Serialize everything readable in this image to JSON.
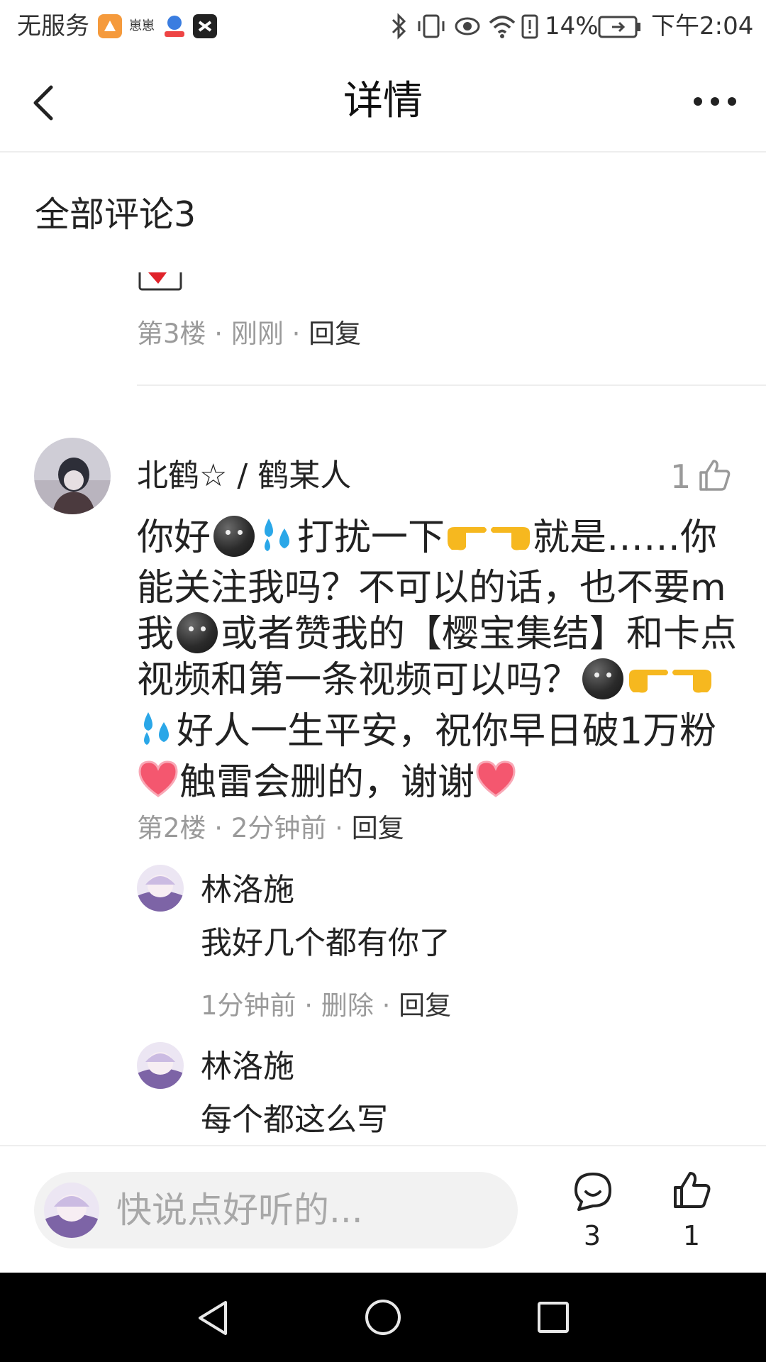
{
  "status_bar": {
    "carrier": "无服务",
    "app_icon_2_text": "崽崽",
    "battery_percent": "14%",
    "time": "下午2:04"
  },
  "header": {
    "title": "详情"
  },
  "comments_section": {
    "title": "全部评论3"
  },
  "floor3": {
    "floor": "第3楼",
    "sep1": " · ",
    "time": "刚刚",
    "sep2": " · ",
    "reply": "回复"
  },
  "floor2": {
    "username": "北鹤☆ / 鹤某人",
    "like_count": "1",
    "body": {
      "p1": "你好",
      "p2": "打扰一下",
      "p3": "就是……你能关注我吗？不可以的话，也不要m我",
      "p4": "或者赞我的【樱宝集结】和卡点视频和第一条视频可以吗？",
      "p5": "好人一生平安，祝你早日破1万粉",
      "p6": "触雷会删的，谢谢"
    },
    "floor": "第2楼",
    "sep1": " · ",
    "time": "2分钟前",
    "sep2": " · ",
    "reply": "回复",
    "replies": [
      {
        "name": "林洛施",
        "text": "我好几个都有你了",
        "time": "1分钟前",
        "sep1": " · ",
        "delete": "删除",
        "sep2": " · ",
        "reply": "回复"
      },
      {
        "name": "林洛施",
        "text": "每个都这么写"
      }
    ]
  },
  "bottom_bar": {
    "input_placeholder": "快说点好听的...",
    "comment_count": "3",
    "like_count": "1"
  },
  "colors": {
    "text_primary": "#222222",
    "text_secondary": "#9a9a9a",
    "divider": "#eeeeee",
    "input_bg": "#f2f2f2",
    "navbar": "#000000"
  },
  "icons": [
    "back-icon",
    "more-icon",
    "thumbs-up-icon",
    "comment-icon",
    "nav-back-icon",
    "nav-home-icon",
    "nav-recents-icon"
  ]
}
